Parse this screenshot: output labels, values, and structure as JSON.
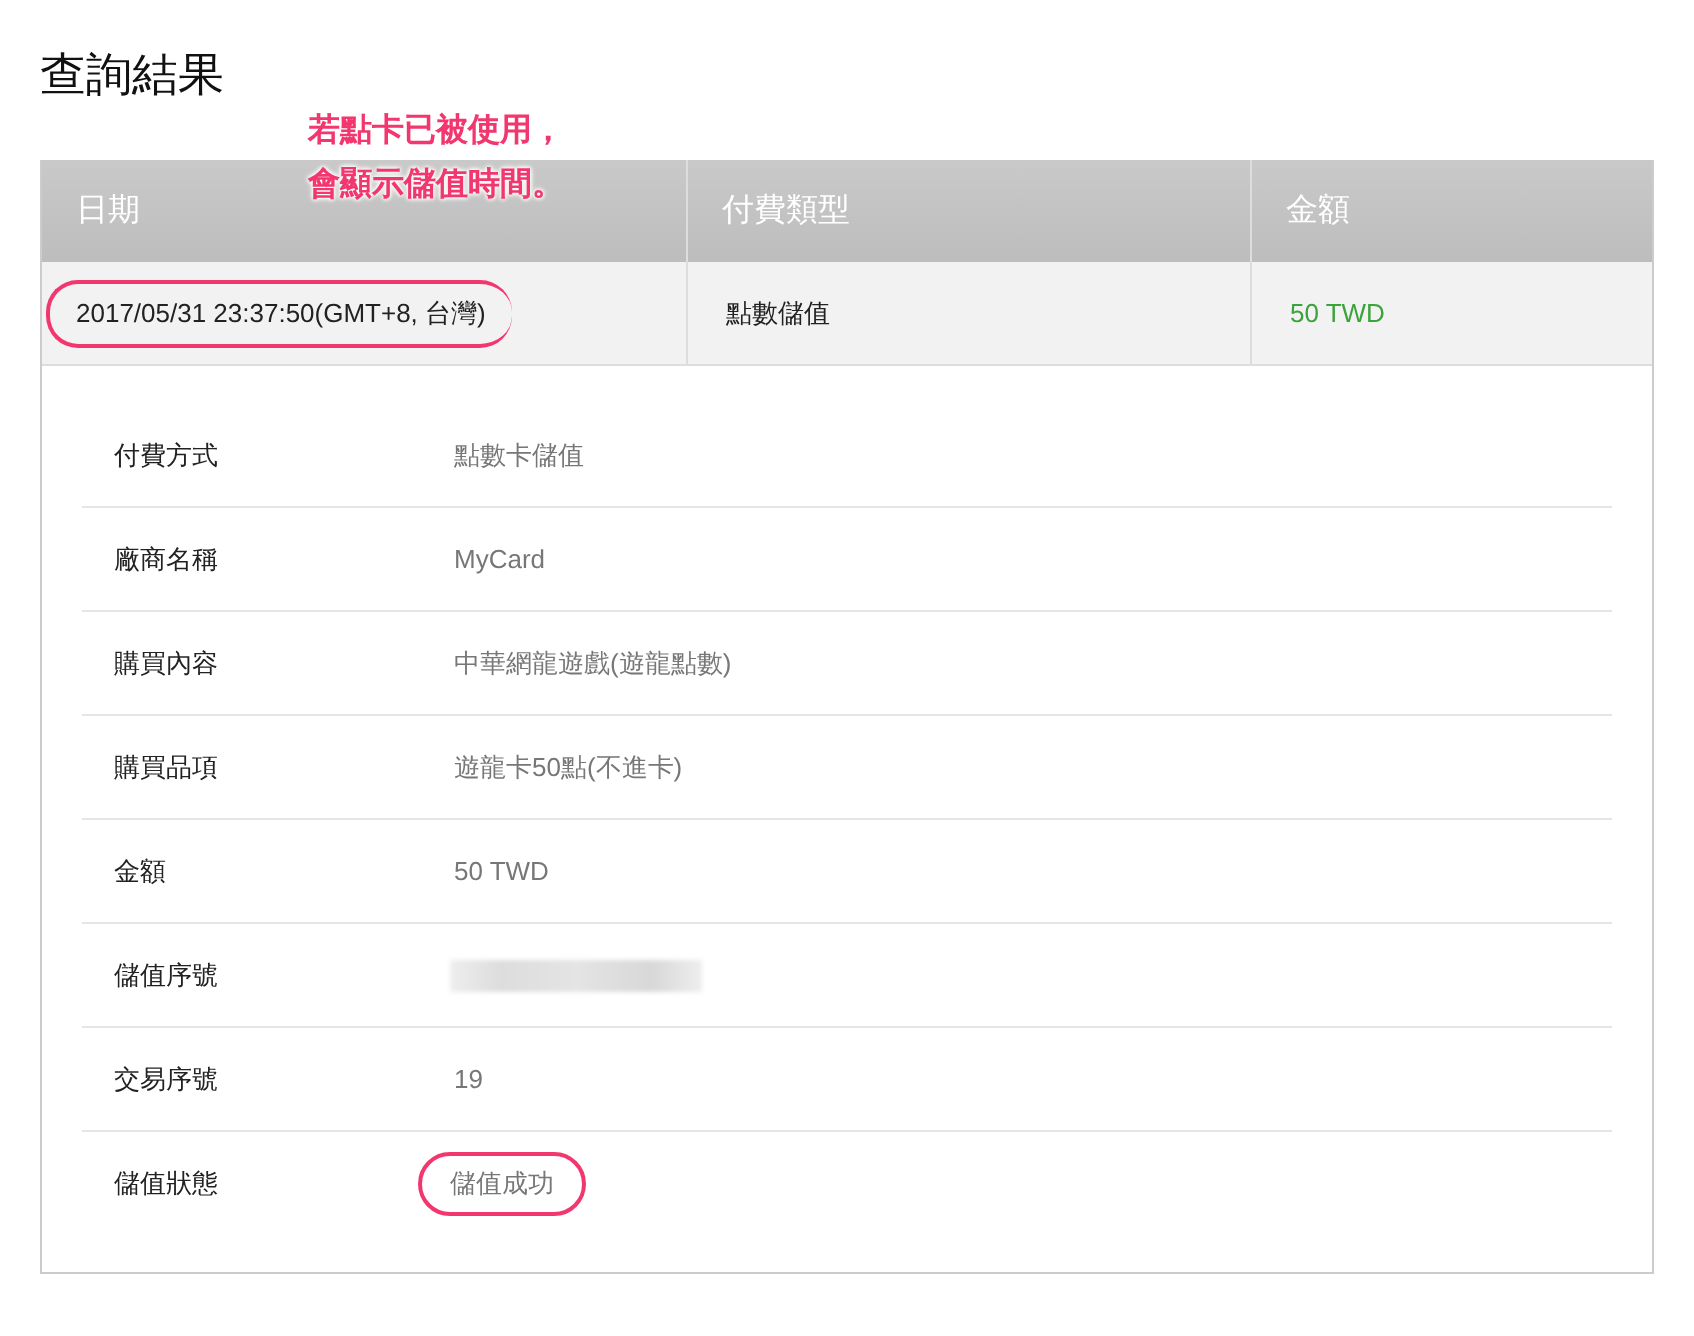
{
  "title": "查詢結果",
  "annotation": {
    "lines": [
      "若點卡已被使用，",
      "會顯示儲值時間。"
    ]
  },
  "table": {
    "columns": [
      {
        "label": "日期",
        "kind": "text"
      },
      {
        "label": "付費類型",
        "kind": "text"
      },
      {
        "label": "金額",
        "kind": "amount"
      }
    ],
    "row": [
      {
        "text": "2017/05/31 23:37:50(GMT+8, 台灣)",
        "highlighted": true
      },
      {
        "text": "點數儲值",
        "highlighted": false
      },
      {
        "text": "50 TWD",
        "highlighted": false
      }
    ]
  },
  "details": [
    {
      "label": "付費方式",
      "kind": "text",
      "value": "點數卡儲值",
      "highlighted": false
    },
    {
      "label": "廠商名稱",
      "kind": "text",
      "value": "MyCard",
      "highlighted": false
    },
    {
      "label": "購買內容",
      "kind": "text",
      "value": "中華網龍遊戲(遊龍點數)",
      "highlighted": false
    },
    {
      "label": "購買品項",
      "kind": "text",
      "value": "遊龍卡50點(不進卡)",
      "highlighted": false
    },
    {
      "label": "金額",
      "kind": "text",
      "value": "50 TWD",
      "highlighted": false
    },
    {
      "label": "儲值序號",
      "kind": "redacted"
    },
    {
      "label": "交易序號",
      "kind": "text",
      "value": "19",
      "highlighted": false
    },
    {
      "label": "儲值狀態",
      "kind": "text",
      "value": "儲值成功",
      "highlighted": true
    }
  ]
}
